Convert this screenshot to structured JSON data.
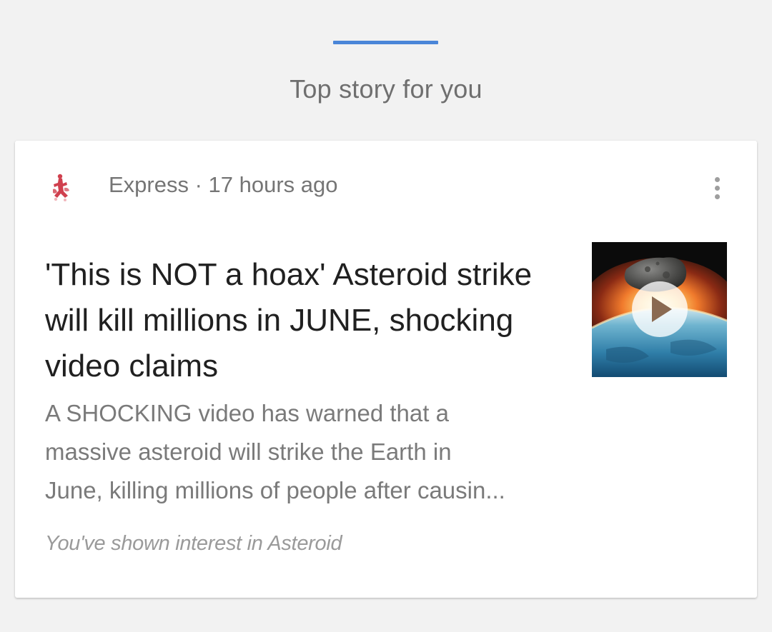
{
  "header": {
    "title": "Top story for you",
    "accent_color": "#4a86d8"
  },
  "card": {
    "source": {
      "name": "Express",
      "separator": " · ",
      "time": "17 hours ago",
      "logo_icon": "express-crusader-logo"
    },
    "menu_icon": "more-vert-icon",
    "headline": "'This is NOT a hoax' Asteroid strike will kill millions in JUNE, shocking video claims",
    "snippet_lines": [
      "A SHOCKING video has warned that a",
      "massive asteroid will strike the Earth in",
      "June, killing millions of people after causin..."
    ],
    "thumbnail": {
      "description_icon": "asteroid-earth-video-thumbnail",
      "play_icon": "play-icon"
    },
    "interest_note": "You've shown interest in Asteroid"
  }
}
